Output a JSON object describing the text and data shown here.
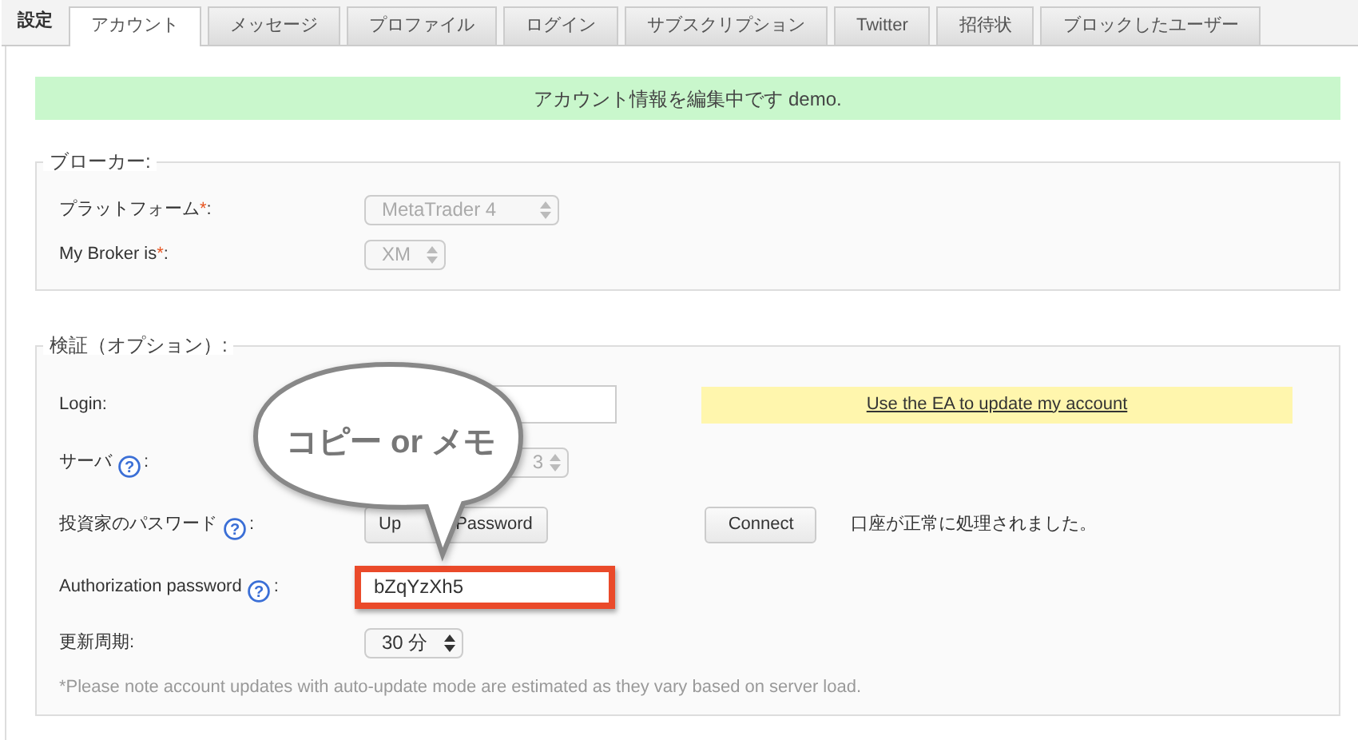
{
  "tab_bar": {
    "label": "設定",
    "tabs": [
      {
        "label": "アカウント",
        "selected": true
      },
      {
        "label": "メッセージ",
        "selected": false
      },
      {
        "label": "プロファイル",
        "selected": false
      },
      {
        "label": "ログイン",
        "selected": false
      },
      {
        "label": "サブスクリプション",
        "selected": false
      },
      {
        "label": "Twitter",
        "selected": false
      },
      {
        "label": "招待状",
        "selected": false
      },
      {
        "label": "ブロックしたユーザー",
        "selected": false
      }
    ]
  },
  "banner": "アカウント情報を編集中です demo.",
  "broker": {
    "legend": "ブローカー:",
    "rows": [
      {
        "label": "プラットフォーム",
        "required_mark": "*",
        "suffix": ":",
        "value": "MetaTrader 4",
        "disabled": true
      },
      {
        "label": "My Broker is",
        "required_mark": "*",
        "suffix": ":",
        "value": "XM",
        "disabled": true
      }
    ]
  },
  "verification": {
    "legend": "検証（オプション）:",
    "login": {
      "label": "Login:"
    },
    "ea_link": "Use the EA to update my account",
    "server": {
      "label": "サーバ",
      "help": "?",
      "suffix": ":",
      "value": "3",
      "disabled": true
    },
    "investor_password": {
      "label": "投資家のパスワード",
      "help": "?",
      "suffix": ":",
      "button_parts": [
        "Up",
        "Password"
      ],
      "connect": "Connect",
      "status": "口座が正常に処理されました。"
    },
    "authorization": {
      "label": "Authorization password",
      "help": "?",
      "suffix": ":",
      "value": "bZqYzXh5",
      "highlighted": true
    },
    "update_interval": {
      "label": "更新周期:",
      "value": "30 分",
      "disabled": false
    },
    "note": "*Please note account updates with auto-update mode are estimated as they vary based on server load."
  },
  "callout": {
    "text": "コピー or メモ"
  }
}
